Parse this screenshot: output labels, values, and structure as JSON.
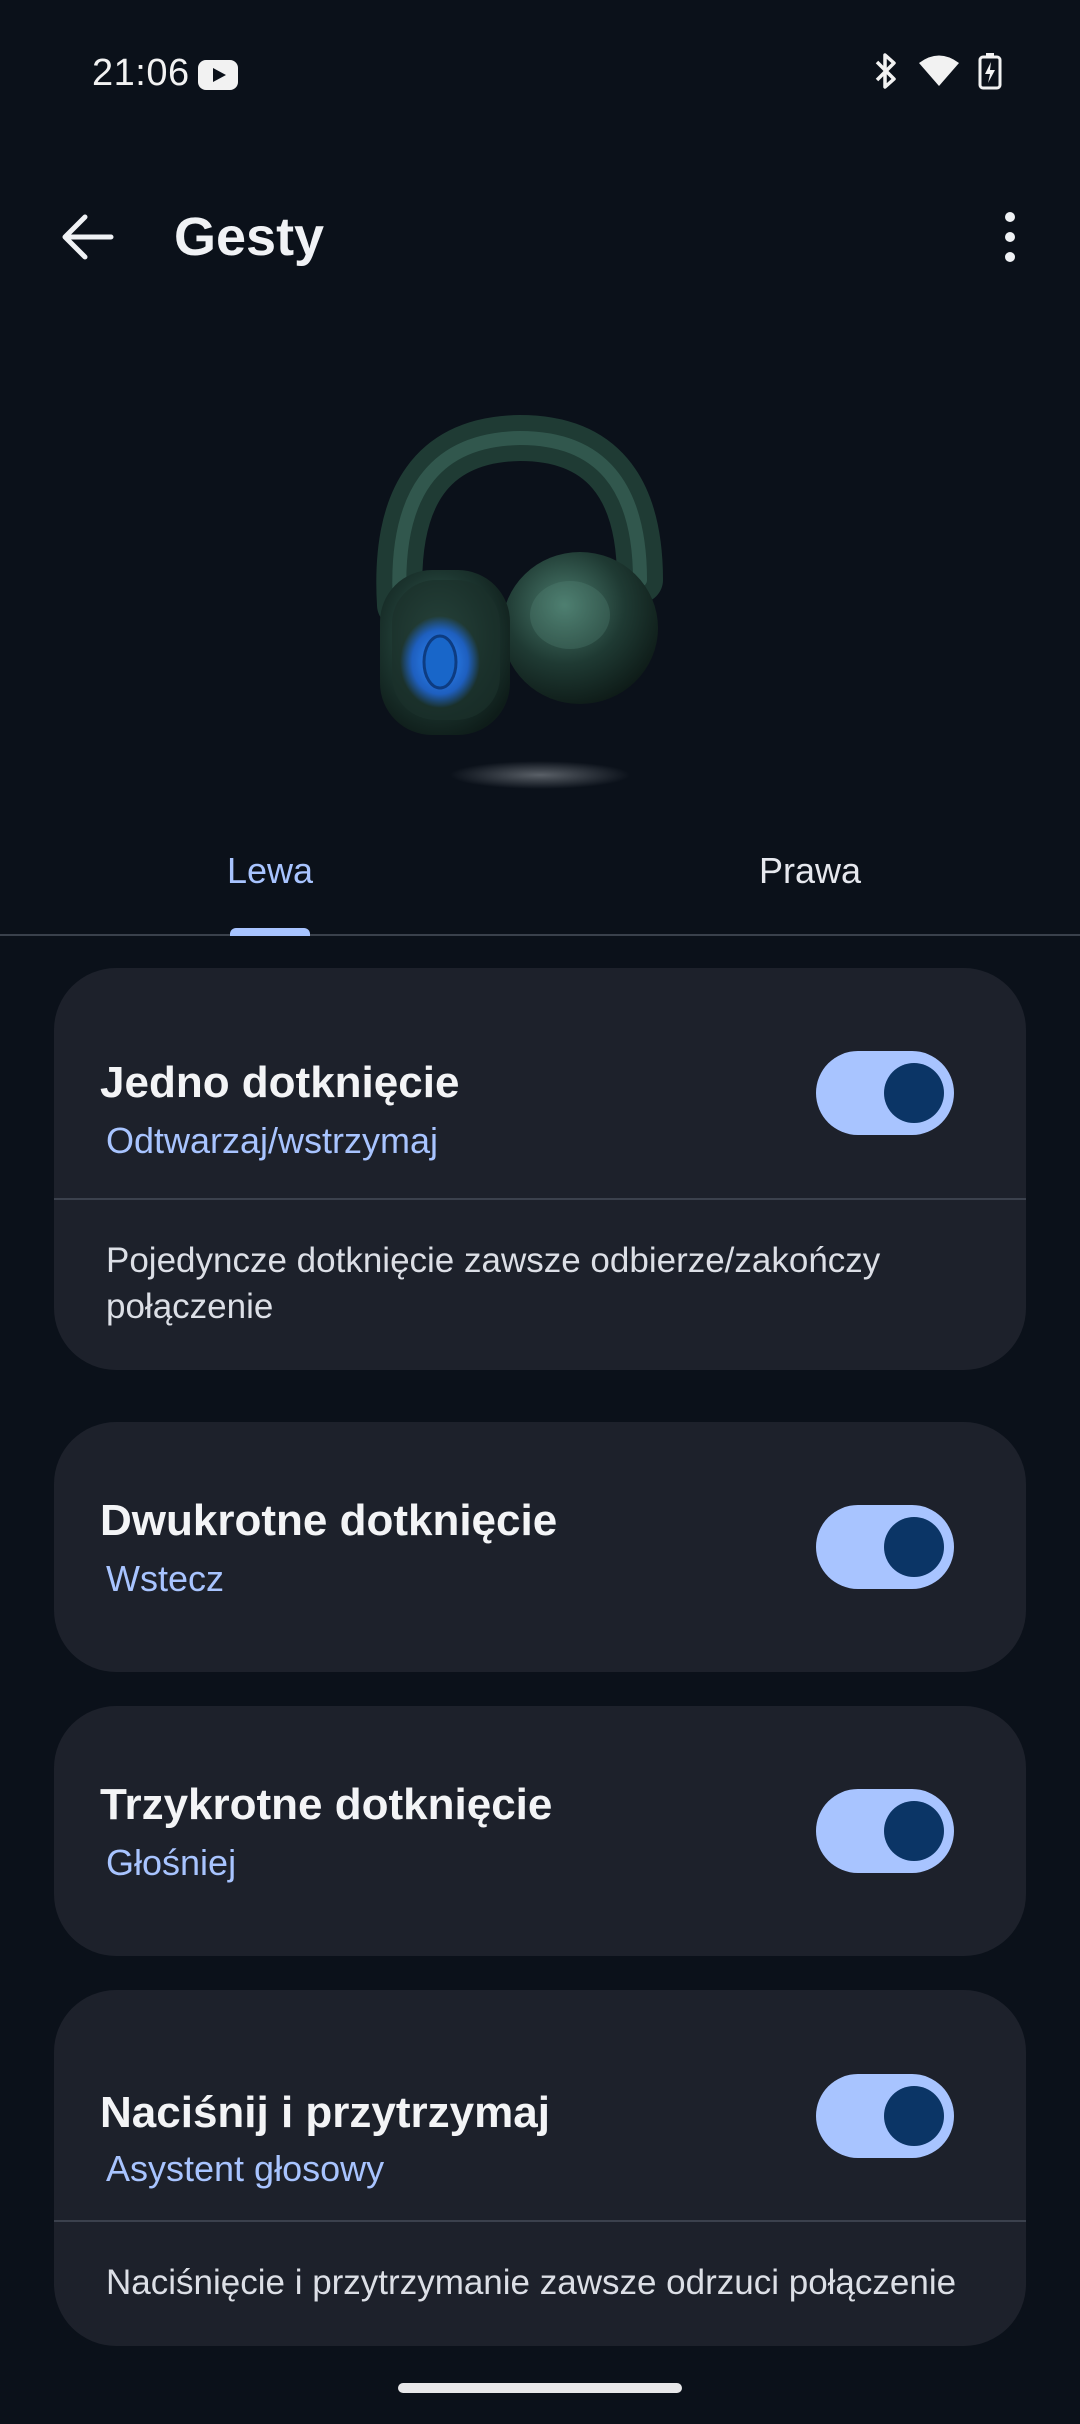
{
  "status_bar": {
    "time": "21:06",
    "icons": [
      "youtube-icon",
      "bluetooth-icon",
      "wifi-icon",
      "battery-charging-icon"
    ]
  },
  "app_bar": {
    "title": "Gesty",
    "back_icon": "arrow-left-icon",
    "more_icon": "more-vert-icon"
  },
  "hero": {
    "image": "headphones-illustration"
  },
  "tabs": [
    {
      "label": "Lewa",
      "selected": true
    },
    {
      "label": "Prawa",
      "selected": false
    }
  ],
  "gestures": [
    {
      "title": "Jedno dotknięcie",
      "action": "Odtwarzaj/wstrzymaj",
      "enabled": true,
      "note": "Pojedyncze dotknięcie zawsze odbierze/zakończy połączenie"
    },
    {
      "title": "Dwukrotne dotknięcie",
      "action": "Wstecz",
      "enabled": true
    },
    {
      "title": "Trzykrotne dotknięcie",
      "action": "Głośniej",
      "enabled": true
    },
    {
      "title": "Naciśnij i przytrzymaj",
      "action": "Asystent głosowy",
      "enabled": true,
      "note": "Naciśnięcie i przytrzymanie zawsze odrzuci połączenie"
    }
  ],
  "colors": {
    "background": "#0b111a",
    "card": "#1d212b",
    "accent": "#a8c4ff",
    "toggle_thumb": "#0b3566"
  }
}
